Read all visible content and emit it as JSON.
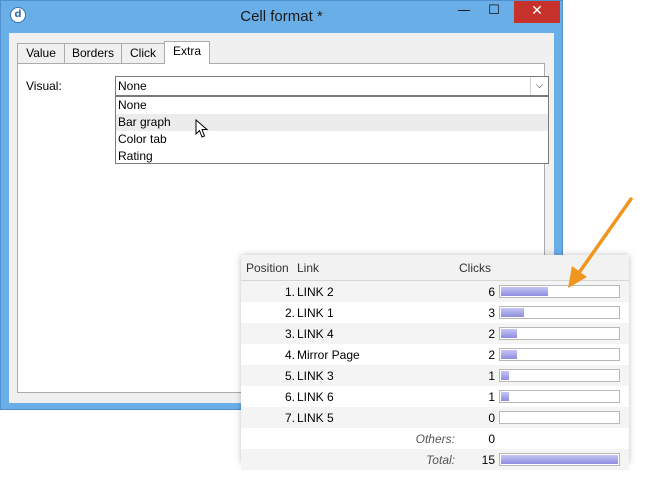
{
  "window": {
    "title": "Cell format *",
    "minimize_glyph": "—",
    "maximize_glyph": "☐",
    "close_glyph": "✕"
  },
  "tabs": [
    "Value",
    "Borders",
    "Click",
    "Extra"
  ],
  "active_tab": "Extra",
  "visual": {
    "label": "Visual:",
    "selected": "None",
    "options": [
      "None",
      "Bar graph",
      "Color tab",
      "Rating"
    ],
    "hovered_option": "Bar graph"
  },
  "stats_table": {
    "headers": {
      "position": "Position",
      "link": "Link",
      "clicks": "Clicks"
    },
    "rows": [
      {
        "position": "1.",
        "link": "LINK 2",
        "clicks": "6",
        "share": 0.4
      },
      {
        "position": "2.",
        "link": "LINK 1",
        "clicks": "3",
        "share": 0.2
      },
      {
        "position": "3.",
        "link": "LINK 4",
        "clicks": "2",
        "share": 0.133
      },
      {
        "position": "4.",
        "link": "Mirror Page",
        "clicks": "2",
        "share": 0.133
      },
      {
        "position": "5.",
        "link": "LINK 3",
        "clicks": "1",
        "share": 0.067
      },
      {
        "position": "6.",
        "link": "LINK 6",
        "clicks": "1",
        "share": 0.067
      },
      {
        "position": "7.",
        "link": "LINK 5",
        "clicks": "0",
        "share": 0
      }
    ],
    "others": {
      "label": "Others:",
      "clicks": "0"
    },
    "total": {
      "label": "Total:",
      "clicks": "15",
      "share": 1.0
    }
  },
  "colors": {
    "window_frame": "#6aaee8",
    "close_button": "#c7312b",
    "bar_fill": "#a9a9ec",
    "arrow": "#f0961e"
  }
}
